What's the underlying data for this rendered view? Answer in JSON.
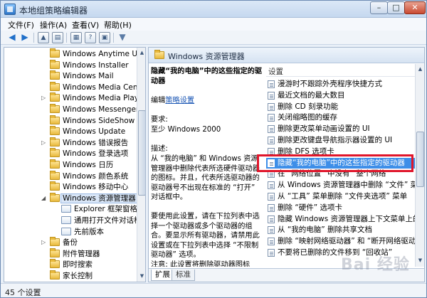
{
  "window": {
    "title": "本地组策略编辑器"
  },
  "title_buttons": {
    "minimize": "–",
    "maximize": "□",
    "close": "✕"
  },
  "menu": [
    "文件(F)",
    "操作(A)",
    "查看(V)",
    "帮助(H)"
  ],
  "tree": [
    {
      "label": "Windows Anytime Upg",
      "exp": "",
      "indent": 64
    },
    {
      "label": "Windows Installer",
      "exp": "",
      "indent": 64
    },
    {
      "label": "Windows Mail",
      "exp": "",
      "indent": 64
    },
    {
      "label": "Windows Media Cente",
      "exp": "",
      "indent": 64
    },
    {
      "label": "Windows Media Playe",
      "exp": "▷",
      "indent": 64
    },
    {
      "label": "Windows Messenger",
      "exp": "",
      "indent": 64
    },
    {
      "label": "Windows SideShow",
      "exp": "",
      "indent": 64
    },
    {
      "label": "Windows Update",
      "exp": "",
      "indent": 64
    },
    {
      "label": "Windows 错误报告",
      "exp": "▷",
      "indent": 64
    },
    {
      "label": "Windows 登录选项",
      "exp": "",
      "indent": 64
    },
    {
      "label": "Windows 日历",
      "exp": "",
      "indent": 64
    },
    {
      "label": "Windows 颜色系统",
      "exp": "",
      "indent": 64
    },
    {
      "label": "Windows 移动中心",
      "exp": "",
      "indent": 64
    },
    {
      "label": "Windows 资源管理器",
      "exp": "◢",
      "indent": 64,
      "selected": true
    },
    {
      "label": "Explorer 框架窗格",
      "exp": "",
      "indent": 80,
      "policy": true
    },
    {
      "label": "通用打开文件对话框",
      "exp": "",
      "indent": 80,
      "policy": true
    },
    {
      "label": "先前版本",
      "exp": "",
      "indent": 80,
      "policy": true
    },
    {
      "label": "备份",
      "exp": "▷",
      "indent": 64
    },
    {
      "label": "附件管理器",
      "exp": "",
      "indent": 64
    },
    {
      "label": "即时搜索",
      "exp": "",
      "indent": 64
    },
    {
      "label": "家长控制",
      "exp": "",
      "indent": 64
    }
  ],
  "right_header": "Windows 资源管理器",
  "description": {
    "title": "隐藏“我的电脑”中的这些指定的驱动器",
    "edit_prefix": "编辑",
    "edit_link": "策略设置",
    "req_label": "要求:",
    "req_value": "至少 Windows 2000",
    "desc_label": "描述:",
    "desc_body": "从 “我的电脑” 和 Windows 资源管理器中删除代表所选硬件驱动器的图标。并且，代表所选驱动器的驱动器号不出现在标准的 “打开” 对话框中。",
    "usage": "要使用此设置，请在下拉列表中选择一个驱动器或多个驱动器的组合。要显示所有驱动器，请禁用此设置或在下拉列表中选择 “不限制驱动器” 选项。",
    "note": "注意: 此设置将删除驱动器图标"
  },
  "settings_header": "设置",
  "settings": [
    "漫游时不跟踪外壳程序快捷方式",
    "最近文档的最大数目",
    "删除 CD 刻录功能",
    "关闭缩略图的缓存",
    "删除更改菜单动画设置的 UI",
    "删除更改键盘导航指示器设置的 UI",
    "删除 DFS 选项卡",
    "隐藏“我的电脑”中的这些指定的驱动器",
    "在 “网络位置” 中没有 “整个网络”",
    "从 Windows 资源管理器中删除 “文件” 菜单",
    "从 “工具” 菜单删除 “文件夹选项” 菜单",
    "删除 “硬件” 选项卡",
    "隐藏 Windows 资源管理器上下文菜单上的 “管理”",
    "从 “我的电脑” 删除共享文档",
    "删除 “映射网络驱动器” 和 “断开网络驱动器”",
    "不要将已删除的文件移到 “回收站”"
  ],
  "selected_setting": 7,
  "tabs": [
    "扩展",
    "标准"
  ],
  "status": "45 个设置",
  "watermark": "Bai 经验"
}
